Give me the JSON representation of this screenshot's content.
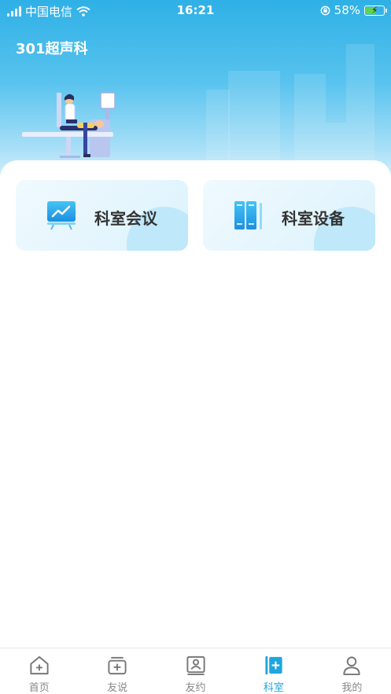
{
  "status_bar": {
    "carrier": "中国电信",
    "time": "16:21",
    "battery": "58%",
    "battery_level": 0.58
  },
  "header": {
    "title": "301超声科"
  },
  "cards": [
    {
      "label": "科室会议",
      "icon": "presentation-chart-icon"
    },
    {
      "label": "科室设备",
      "icon": "equipment-books-icon"
    }
  ],
  "tabs": [
    {
      "label": "首页",
      "icon": "home-plus-icon",
      "active": false
    },
    {
      "label": "友说",
      "icon": "chat-box-icon",
      "active": false
    },
    {
      "label": "友约",
      "icon": "contact-card-icon",
      "active": false
    },
    {
      "label": "科室",
      "icon": "department-icon",
      "active": true
    },
    {
      "label": "我的",
      "icon": "user-icon",
      "active": false
    }
  ],
  "colors": {
    "accent": "#1fa6e0",
    "header_top": "#2fb0e6",
    "inactive_tab": "#888888"
  }
}
